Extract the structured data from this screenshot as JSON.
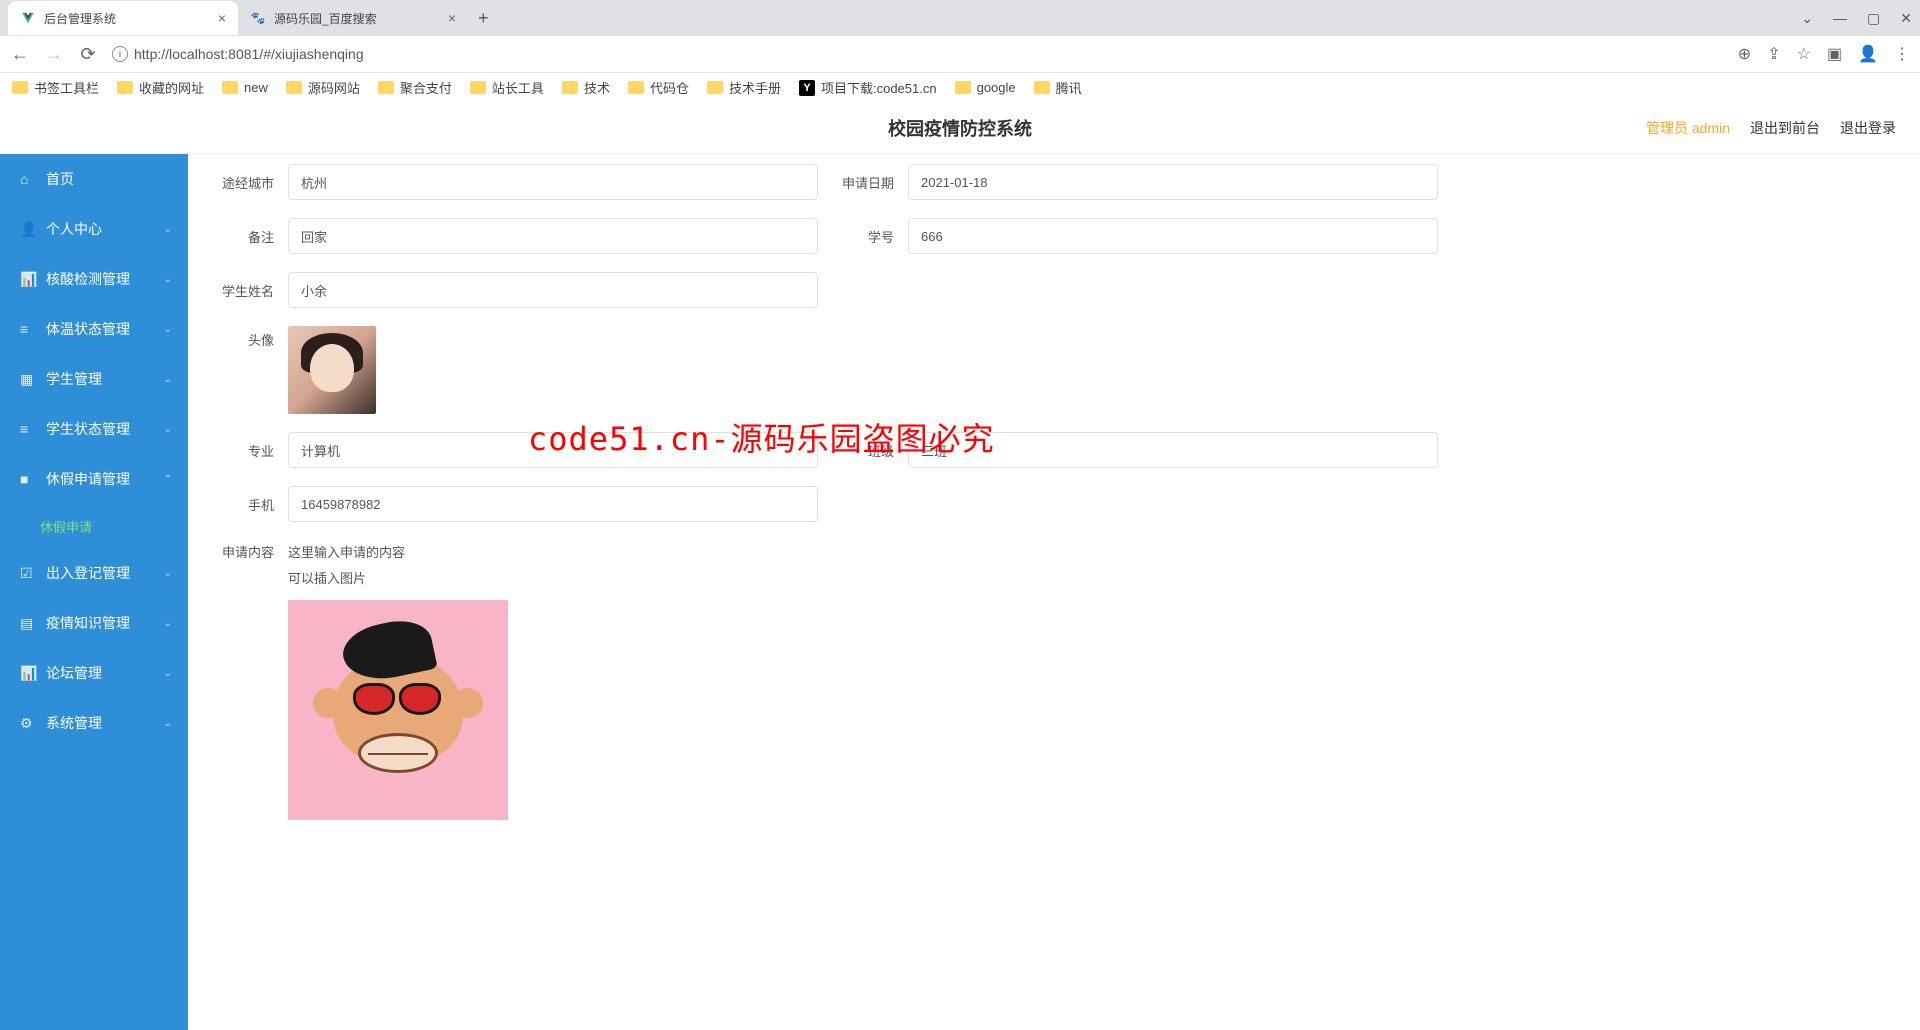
{
  "browser": {
    "tabs": [
      {
        "title": "后台管理系统",
        "active": true
      },
      {
        "title": "源码乐园_百度搜索",
        "active": false
      }
    ],
    "url": "http://localhost:8081/#/xiujiashenqing",
    "bookmarks": [
      {
        "label": "书签工具栏",
        "icon": "folder"
      },
      {
        "label": "收藏的网址",
        "icon": "folder"
      },
      {
        "label": "new",
        "icon": "folder"
      },
      {
        "label": "源码网站",
        "icon": "folder"
      },
      {
        "label": "聚合支付",
        "icon": "folder"
      },
      {
        "label": "站长工具",
        "icon": "folder"
      },
      {
        "label": "技术",
        "icon": "folder"
      },
      {
        "label": "代码仓",
        "icon": "folder"
      },
      {
        "label": "技术手册",
        "icon": "folder"
      },
      {
        "label": "项目下载:code51.cn",
        "icon": "y"
      },
      {
        "label": "google",
        "icon": "folder"
      },
      {
        "label": "腾讯",
        "icon": "folder"
      }
    ]
  },
  "header": {
    "title": "校园疫情防控系统",
    "admin": "管理员 admin",
    "exit_front": "退出到前台",
    "logout": "退出登录"
  },
  "sidebar": {
    "items": [
      {
        "label": "首页",
        "icon": "⌂"
      },
      {
        "label": "个人中心",
        "icon": "👤",
        "expandable": true
      },
      {
        "label": "核酸检测管理",
        "icon": "📊",
        "expandable": true
      },
      {
        "label": "体温状态管理",
        "icon": "≡",
        "expandable": true
      },
      {
        "label": "学生管理",
        "icon": "▦",
        "expandable": true
      },
      {
        "label": "学生状态管理",
        "icon": "≡",
        "expandable": true
      },
      {
        "label": "休假申请管理",
        "icon": "■",
        "expandable": true,
        "expanded": true,
        "sub": [
          {
            "label": "休假申请"
          }
        ]
      },
      {
        "label": "出入登记管理",
        "icon": "☑",
        "expandable": true
      },
      {
        "label": "疫情知识管理",
        "icon": "▤",
        "expandable": true
      },
      {
        "label": "论坛管理",
        "icon": "📊",
        "expandable": true
      },
      {
        "label": "系统管理",
        "icon": "⚙",
        "expandable": true
      }
    ]
  },
  "form": {
    "labels": {
      "city": "途经城市",
      "date": "申请日期",
      "remark": "备注",
      "sid": "学号",
      "name": "学生姓名",
      "avatar": "头像",
      "major": "专业",
      "class": "班级",
      "phone": "手机",
      "content": "申请内容"
    },
    "values": {
      "city": "杭州",
      "date": "2021-01-18",
      "remark": "回家",
      "sid": "666",
      "name": "小余",
      "major": "计算机",
      "class": "三班",
      "phone": "16459878982",
      "content_line1": "这里输入申请的内容",
      "content_line2": "可以插入图片"
    }
  },
  "watermark": "code51.cn-源码乐园盗图必究"
}
